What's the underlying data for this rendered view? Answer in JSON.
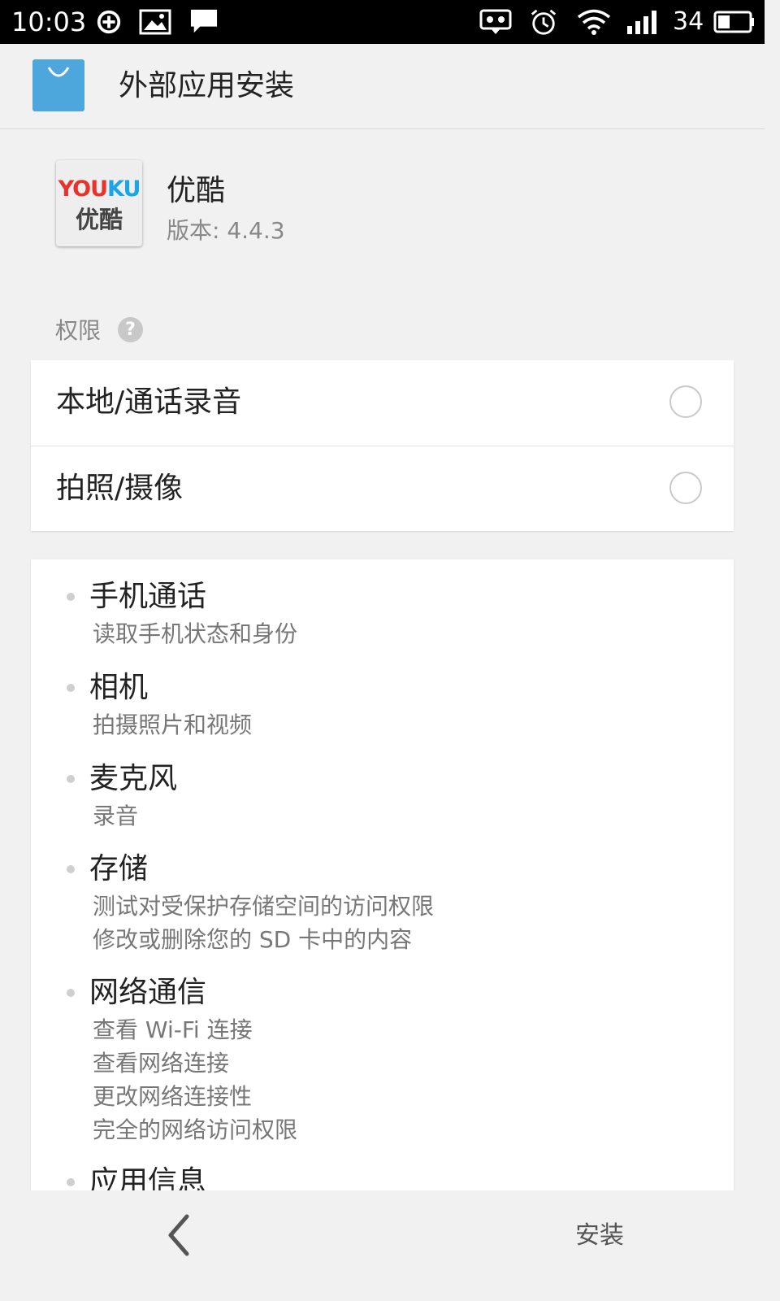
{
  "status_bar": {
    "time": "10:03",
    "battery_level": "34",
    "icons": [
      "sync-icon",
      "image-icon",
      "chat-icon",
      "voicemail-icon",
      "alarm-icon",
      "wifi-icon",
      "signal-3g-icon",
      "battery-icon"
    ]
  },
  "app_bar": {
    "title": "外部应用安装",
    "icon": "app-store-bag-icon"
  },
  "app": {
    "icon_brand": "YOUKU",
    "icon_text": "优酷",
    "name": "优酷",
    "version": "版本: 4.4.3"
  },
  "permissions": {
    "label": "权限",
    "help": "?",
    "toggles": [
      {
        "label": "本地/通话录音",
        "checked": false
      },
      {
        "label": "拍照/摄像",
        "checked": false
      }
    ],
    "groups": [
      {
        "title": "手机通话",
        "lines": [
          "读取手机状态和身份"
        ]
      },
      {
        "title": "相机",
        "lines": [
          "拍摄照片和视频"
        ]
      },
      {
        "title": "麦克风",
        "lines": [
          "录音"
        ]
      },
      {
        "title": "存储",
        "lines": [
          "测试对受保护存储空间的访问权限",
          "修改或删除您的 SD 卡中的内容"
        ]
      },
      {
        "title": "网络通信",
        "lines": [
          "查看 Wi-Fi 连接",
          "查看网络连接",
          "更改网络连接性",
          "完全的网络访问权限"
        ]
      },
      {
        "title": "应用信息",
        "lines": []
      }
    ]
  },
  "bottom_bar": {
    "back_icon": "chevron-left-icon",
    "install_label": "安装"
  },
  "colors": {
    "background": "#f1f1f1",
    "status_bar": "#000000",
    "card": "#ffffff",
    "youku_red": "#e8332c",
    "youku_blue": "#1aa5e6",
    "store_blue": "#4da6dc"
  }
}
